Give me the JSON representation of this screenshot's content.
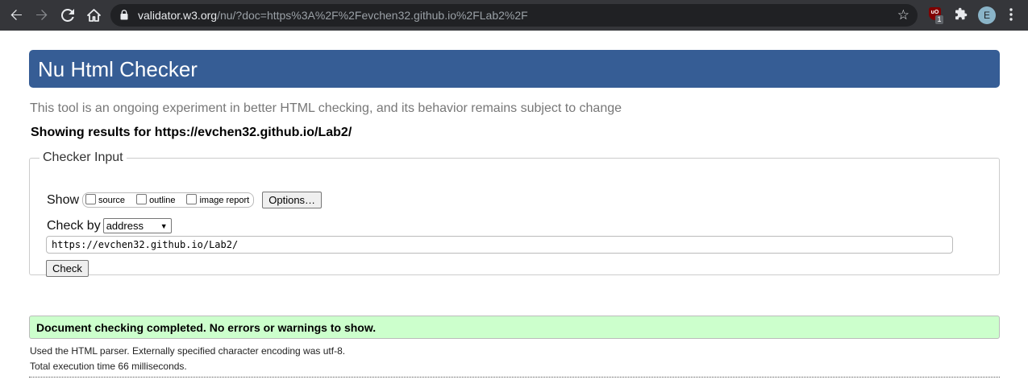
{
  "browser": {
    "url_host": "validator.w3.org",
    "url_rest": "/nu/?doc=https%3A%2F%2Fevchen32.github.io%2FLab2%2F",
    "extension_badge_count": "1",
    "ublock_label": "uO",
    "profile_initial": "E",
    "icons": {
      "back": "back-arrow-icon",
      "forward": "forward-arrow-icon",
      "reload": "reload-icon",
      "home": "home-icon",
      "lock": "lock-icon",
      "star": "star-icon",
      "extensions": "puzzle-icon",
      "menu": "kebab-menu-icon"
    }
  },
  "page": {
    "title": "Nu Html Checker",
    "tagline": "This tool is an ongoing experiment in better HTML checking, and its behavior remains subject to change",
    "showing_results": "Showing results for https://evchen32.github.io/Lab2/",
    "checker_input": {
      "legend": "Checker Input",
      "show_label": "Show",
      "show_options": [
        "source",
        "outline",
        "image report"
      ],
      "options_button": "Options…",
      "check_by_label": "Check by",
      "check_by_value": "address",
      "url_value": "https://evchen32.github.io/Lab2/",
      "check_button": "Check"
    },
    "result": {
      "message": "Document checking completed. No errors or warnings to show.",
      "parser_info": "Used the HTML parser. Externally specified character encoding was utf-8.",
      "execution_time": "Total execution time 66 milliseconds."
    }
  },
  "colors": {
    "header_bg": "#365d95",
    "success_bg": "#ccffcc",
    "chrome_bg": "#35363a",
    "omnibox_bg": "#202124"
  }
}
